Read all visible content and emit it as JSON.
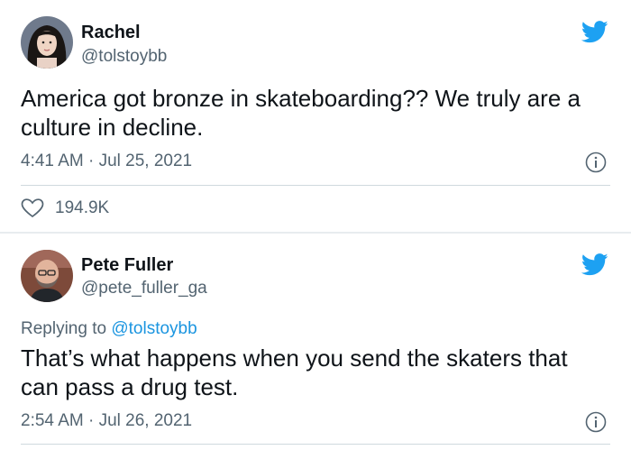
{
  "tweets": [
    {
      "display_name": "Rachel",
      "handle": "@tolstoybb",
      "text": "America got bronze in skateboarding?? We truly are a culture in decline.",
      "timestamp": "4:41 AM · Jul 25, 2021",
      "likes": "194.9K",
      "avatar_icon": "avatar-woman-dark-hair"
    },
    {
      "display_name": "Pete Fuller",
      "handle": "@pete_fuller_ga",
      "reply_prefix": "Replying to",
      "reply_to": "@tolstoybb",
      "text": "That’s what happens when you send the skaters that can pass a drug test.",
      "timestamp": "2:54 AM · Jul 26, 2021",
      "avatar_icon": "avatar-man-bald-beard"
    }
  ],
  "icons": {
    "brand": "twitter-bird-icon",
    "info": "info-icon",
    "like": "heart-icon"
  },
  "colors": {
    "brand_blue": "#1da1f2",
    "link_blue": "#1b95e0",
    "secondary_text": "#536471",
    "primary_text": "#0f1419"
  }
}
